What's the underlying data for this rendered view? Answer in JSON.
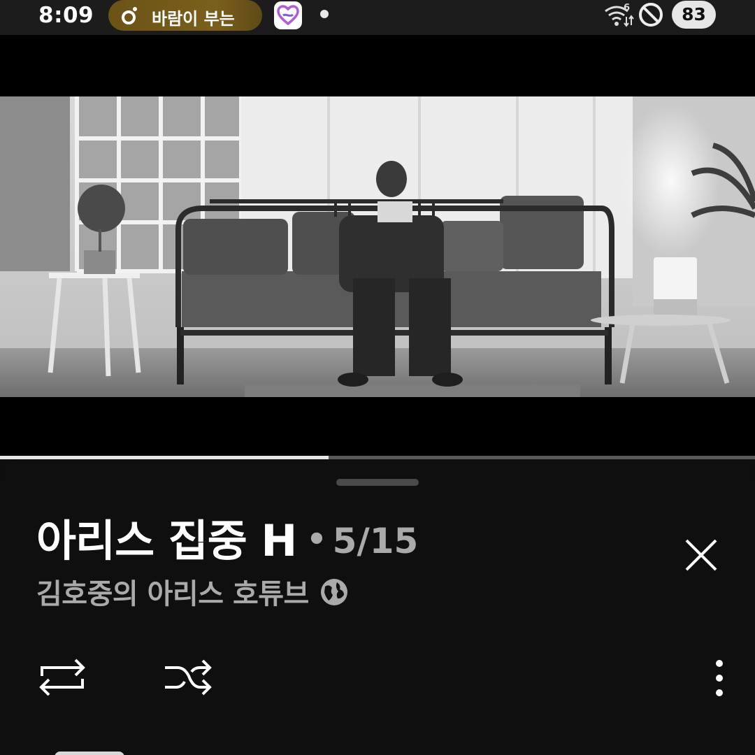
{
  "status_bar": {
    "time": "8:09",
    "now_playing_text": "바람이 부는",
    "battery": "83",
    "icons": [
      "music-note-icon",
      "heart-app-icon",
      "wifi-6-icon",
      "do-not-disturb-icon"
    ]
  },
  "player": {
    "progress": 0.435,
    "video_icon": "video-frame"
  },
  "sheet": {
    "playlist_title": "아리스 집중 H",
    "separator": "•",
    "position": "5/15",
    "channel_name": "김호중의 아리스 호튜브",
    "icons": {
      "close": "close-icon",
      "visibility": "globe-icon",
      "repeat": "repeat-icon",
      "shuffle": "shuffle-icon",
      "more": "more-vertical-icon"
    }
  },
  "colors": {
    "background": "#0f0f0f",
    "status_bar": "#1c1c1c",
    "pill": "#7a5f1c",
    "secondary_text": "#aaaaaa"
  }
}
